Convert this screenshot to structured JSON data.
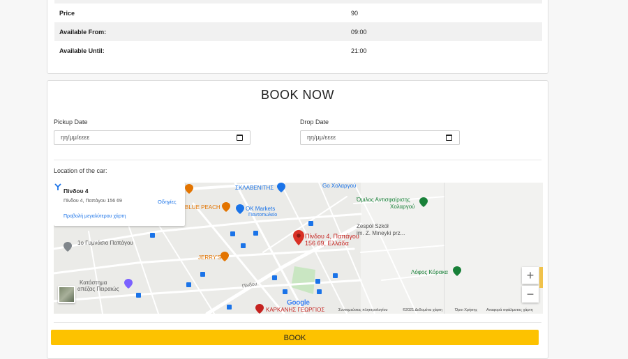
{
  "details": {
    "rows": [
      {
        "label": "Price",
        "value": "90"
      },
      {
        "label": "Available From:",
        "value": "09:00"
      },
      {
        "label": "Available Until:",
        "value": "21:00"
      }
    ]
  },
  "booking": {
    "title": "BOOK NOW",
    "pickup_label": "Pickup Date",
    "pickup_placeholder": "ηη/μμ/εεεε",
    "drop_label": "Drop Date",
    "drop_placeholder": "ηη/μμ/εεεε",
    "location_label": "Location of the car:",
    "book_button": "BOOK"
  },
  "map": {
    "infobox": {
      "title": "Πίνδου 4",
      "address": "Πίνδου 4, Παπάγου 156 69",
      "directions": "Οδηγίες",
      "larger_map_link": "Προβολή μεγαλύτερου χάρτη"
    },
    "marker_label_line1": "Πίνδου 4, Παπάγου",
    "marker_label_line2": "156 69, Ελλάδα",
    "places": {
      "sklavenitis": "ΣΚΛΑΒΕΝΙΤΗΣ",
      "go_cholargou": "Go Χολαργού",
      "antisfairisis_line1": "Όμιλος Αντισφαίρισης",
      "antisfairisis_line2": "Χολαργού",
      "blue_peach": "BLUE PEACH",
      "ok_markets_line1": "OK Markets",
      "ok_markets_line2": "Παντοπωλείο",
      "zespol_line1": "Zespół Szkół",
      "zespol_line2": "im. Z. Mineyki prz...",
      "gymnasio": "1ο Γυμνάσιο Παπάγου",
      "jerrys": "JERRY'S",
      "lofos": "Λόφος Κόρακα",
      "katastima_line1": "Κατάστημα",
      "katastima_line2": "απέζας Πειραιώς",
      "karkanis": "ΚΑΡΚΑΝΗΣ ΓΕΩΡΓΙΟΣ",
      "pindou_street": "Πίνδου"
    },
    "zoom_in": "+",
    "zoom_out": "−",
    "google_logo": "Google",
    "attribution": {
      "shortcuts": "Συντομεύσεις πληκτρολογίου",
      "data": "©2021 Δεδομένα χάρτη",
      "terms": "Όροι Χρήσης",
      "report": "Αναφορά σφάλματος χάρτη"
    },
    "colors": {
      "marker": "#d93025",
      "road": "#ffffff",
      "land": "#ebebe8",
      "park": "#c9e6c2",
      "transit": "#1a73e8"
    }
  }
}
